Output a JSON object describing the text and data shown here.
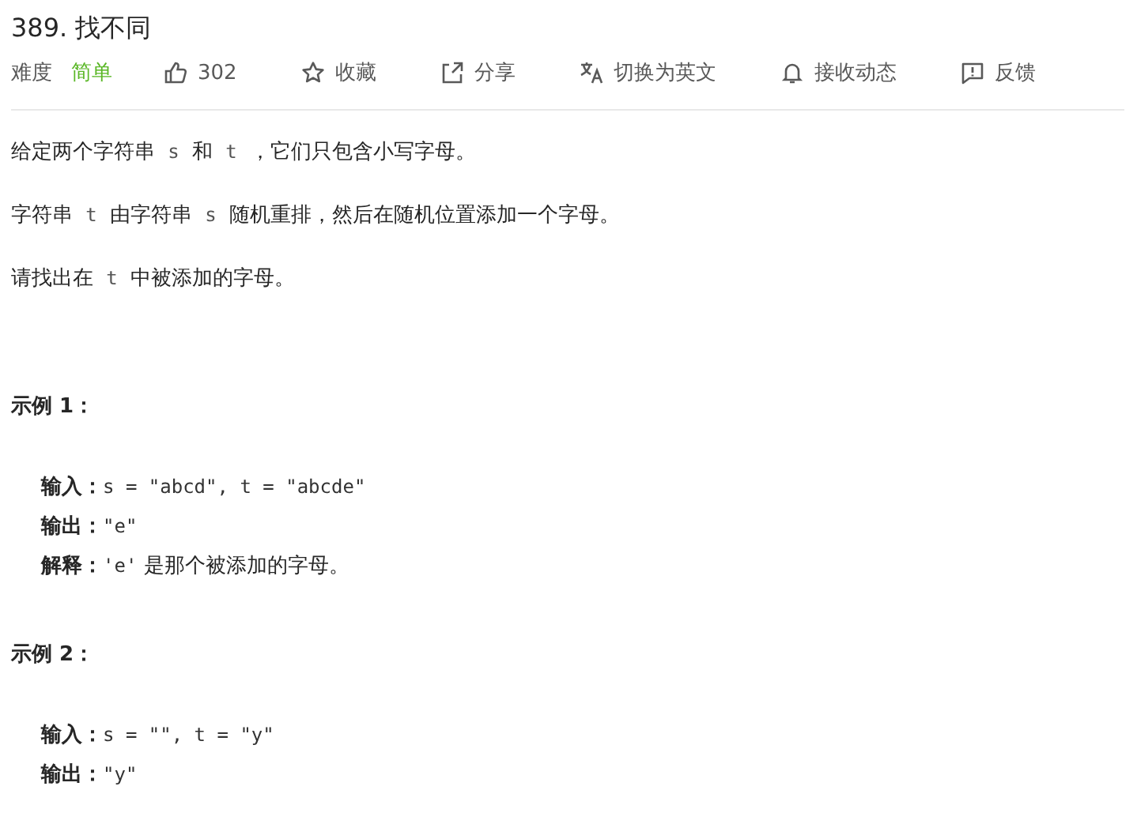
{
  "title": "389. 找不同",
  "toolbar": {
    "difficulty_label": "难度",
    "difficulty": "简单",
    "actions": [
      {
        "kind": "like",
        "label": "302"
      },
      {
        "kind": "star",
        "label": "收藏"
      },
      {
        "kind": "share",
        "label": "分享"
      },
      {
        "kind": "translate",
        "label": "切换为英文"
      },
      {
        "kind": "bell",
        "label": "接收动态"
      },
      {
        "kind": "feedback",
        "label": "反馈"
      }
    ]
  },
  "description": [
    [
      {
        "kind": "text",
        "text": "给定两个字符串 "
      },
      {
        "kind": "code",
        "text": "s"
      },
      {
        "kind": "text",
        "text": " 和 "
      },
      {
        "kind": "code",
        "text": "t"
      },
      {
        "kind": "text",
        "text": " ，它们只包含小写字母。"
      }
    ],
    [
      {
        "kind": "text",
        "text": "字符串 "
      },
      {
        "kind": "code",
        "text": "t"
      },
      {
        "kind": "text",
        "text": " 由字符串 "
      },
      {
        "kind": "code",
        "text": "s"
      },
      {
        "kind": "text",
        "text": " 随机重排，然后在随机位置添加一个字母。"
      }
    ],
    [
      {
        "kind": "text",
        "text": "请找出在 "
      },
      {
        "kind": "code",
        "text": "t"
      },
      {
        "kind": "text",
        "text": " 中被添加的字母。"
      }
    ]
  ],
  "examples": [
    {
      "heading": "示例 1：",
      "lines": [
        [
          {
            "kind": "bold",
            "text": "输入："
          },
          {
            "kind": "mono",
            "text": "s = \"abcd\", t = \"abcde\""
          }
        ],
        [
          {
            "kind": "bold",
            "text": "输出："
          },
          {
            "kind": "mono",
            "text": "\"e\""
          }
        ],
        [
          {
            "kind": "bold",
            "text": "解释："
          },
          {
            "kind": "mono",
            "text": "'e'"
          },
          {
            "kind": "text",
            "text": " 是那个被添加的字母。"
          }
        ]
      ]
    },
    {
      "heading": "示例 2：",
      "lines": [
        [
          {
            "kind": "bold",
            "text": "输入："
          },
          {
            "kind": "mono",
            "text": "s = \"\", t = \"y\""
          }
        ],
        [
          {
            "kind": "bold",
            "text": "输出："
          },
          {
            "kind": "mono",
            "text": "\"y\""
          }
        ]
      ]
    }
  ]
}
